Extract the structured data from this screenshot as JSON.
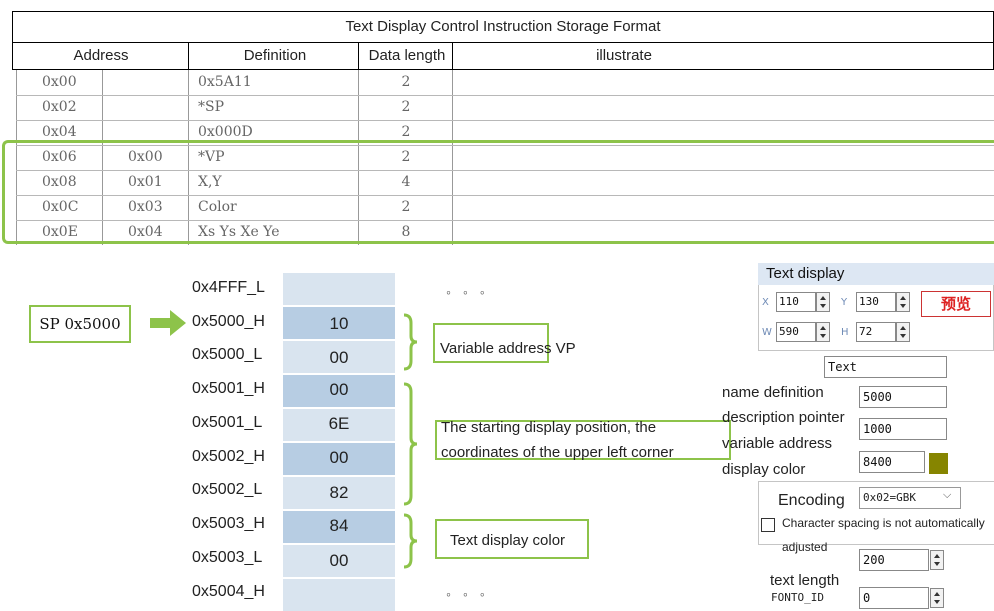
{
  "table": {
    "title": "Text Display Control Instruction Storage Format",
    "headers": {
      "address": "Address",
      "definition": "Definition",
      "data_length": "Data length",
      "illustrate": "illustrate"
    },
    "rows": [
      {
        "addr": "0x00",
        "offset": "",
        "definition": "0x5A11",
        "length": "2"
      },
      {
        "addr": "0x02",
        "offset": "",
        "definition": "*SP",
        "length": "2"
      },
      {
        "addr": "0x04",
        "offset": "",
        "definition": "0x000D",
        "length": "2"
      },
      {
        "addr": "0x06",
        "offset": "0x00",
        "definition": "*VP",
        "length": "2"
      },
      {
        "addr": "0x08",
        "offset": "0x01",
        "definition": "X,Y",
        "length": "4"
      },
      {
        "addr": "0x0C",
        "offset": "0x03",
        "definition": "Color",
        "length": "2"
      },
      {
        "addr": "0x0E",
        "offset": "0x04",
        "definition": "Xs Ys Xe Ye",
        "length": "8"
      }
    ]
  },
  "memory": {
    "sp_label": "SP 0x5000",
    "rows": [
      {
        "addr": "0x4FFF_L",
        "value": ""
      },
      {
        "addr": "0x5000_H",
        "value": "10"
      },
      {
        "addr": "0x5000_L",
        "value": "00"
      },
      {
        "addr": "0x5001_H",
        "value": "00"
      },
      {
        "addr": "0x5001_L",
        "value": "6E"
      },
      {
        "addr": "0x5002_H",
        "value": "00"
      },
      {
        "addr": "0x5002_L",
        "value": "82"
      },
      {
        "addr": "0x5003_H",
        "value": "84"
      },
      {
        "addr": "0x5003_L",
        "value": "00"
      },
      {
        "addr": "0x5004_H",
        "value": ""
      }
    ],
    "notes": {
      "vp": "Variable address VP",
      "position_line1": "The starting display position, the",
      "position_line2": "coordinates of the upper left corner",
      "color": "Text display color"
    },
    "dots": "◦ ◦ ◦"
  },
  "panel": {
    "title": "Text display",
    "x_label": "X",
    "x_value": "110",
    "y_label": "Y",
    "y_value": "130",
    "w_label": "W",
    "w_value": "590",
    "h_label": "H",
    "h_value": "72",
    "preview_label": "预览",
    "text_value": "Text",
    "name_definition_label": "name definition",
    "name_definition_value": "5000",
    "description_pointer_label": "description pointer",
    "description_pointer_value": "1000",
    "variable_address_label": "variable address",
    "display_color_label": "display color",
    "display_color_value": "8400",
    "display_color_swatch": "#868500",
    "encoding_label": "Encoding",
    "encoding_value": "0x02=GBK",
    "spacing_label": "Character spacing is not automatically",
    "adjusted_label": "adjusted",
    "text_length_value": "200",
    "text_length_label": "text length",
    "font_id_label": "FONTO_ID",
    "font_id_value": "0"
  }
}
